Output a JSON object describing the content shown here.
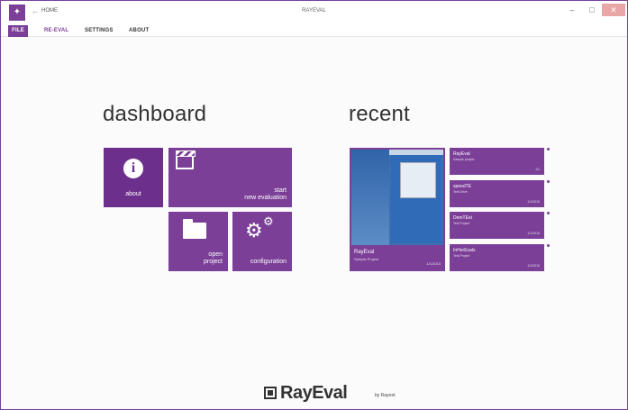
{
  "window": {
    "title": "RAYEVAL",
    "home_label": "HOME",
    "app_icon_glyph": "✦",
    "qa_icon_glyph": "←",
    "minimize_glyph": "–",
    "maximize_glyph": "□",
    "close_glyph": "✕"
  },
  "menu": {
    "file": "FILE",
    "reeval": "RE-EVAL",
    "settings": "SETTINGS",
    "about": "ABOUT"
  },
  "dashboard": {
    "heading": "dashboard",
    "tiles": {
      "about": "about",
      "start_line1": "start",
      "start_line2": "new evaluation",
      "open_line1": "open",
      "open_line2": "project",
      "configuration": "configuration"
    },
    "icons": {
      "info": "i",
      "gear": "⚙",
      "gear_small": "⚙"
    }
  },
  "recent": {
    "heading": "recent",
    "big": {
      "title": "RayEval",
      "subtitle": "Sample Project",
      "date": "1/1/2015"
    },
    "items": [
      {
        "name": "RayEval",
        "subtitle": "Sample project",
        "date": "1/1"
      },
      {
        "name": "speedTE",
        "subtitle": "Test Drive",
        "date": "1/1/2015"
      },
      {
        "name": "DemTEst",
        "subtitle": "Test Project",
        "date": "1/1/2015"
      },
      {
        "name": "InHerEvals",
        "subtitle": "Test Project",
        "date": "1/1/2015"
      }
    ]
  },
  "logo": {
    "text": "RayEval",
    "suffix": "by Raynet"
  },
  "colors": {
    "accent": "#7b3f98",
    "accent_dark": "#6d2f8c",
    "background": "#fbfbfc"
  }
}
